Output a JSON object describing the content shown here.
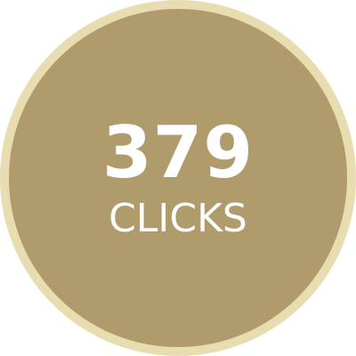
{
  "badge": {
    "count": "379",
    "label": "CLICKS",
    "ring_color": "#e8dcb1",
    "fill_color": "#b09b6c",
    "text_color": "#ffffff"
  }
}
